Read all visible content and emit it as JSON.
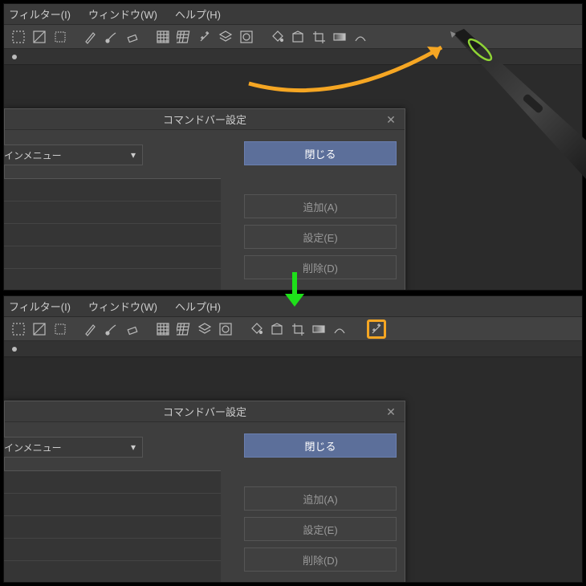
{
  "menu": {
    "filter": "フィルター(I)",
    "window": "ウィンドウ(W)",
    "help": "ヘルプ(H)"
  },
  "dialog": {
    "title": "コマンドバー設定",
    "dropdown_value": "インメニュー",
    "close_btn": "閉じる",
    "add_btn": "追加(A)",
    "settings_btn": "設定(E)",
    "delete_btn": "削除(D)"
  },
  "toolbar_top": {
    "icons": [
      "rect-select",
      "invert-select",
      "marquee",
      "sep",
      "pen",
      "brush",
      "eraser",
      "sep",
      "grid",
      "perspective",
      "wand",
      "layers",
      "mask",
      "sep",
      "bucket",
      "fill",
      "crop",
      "gradient",
      "transform"
    ]
  },
  "toolbar_bottom": {
    "icons": [
      "rect-select",
      "invert-select",
      "marquee",
      "sep",
      "pen",
      "brush",
      "eraser",
      "sep",
      "grid",
      "perspective",
      "layers",
      "mask",
      "sep",
      "bucket",
      "fill",
      "crop",
      "gradient",
      "transform",
      "gap",
      "wand-moved"
    ]
  },
  "annotations": {
    "arrow_color": "#f5a623",
    "down_arrow_color": "#1ee01a",
    "highlight_color": "#f5a623"
  }
}
